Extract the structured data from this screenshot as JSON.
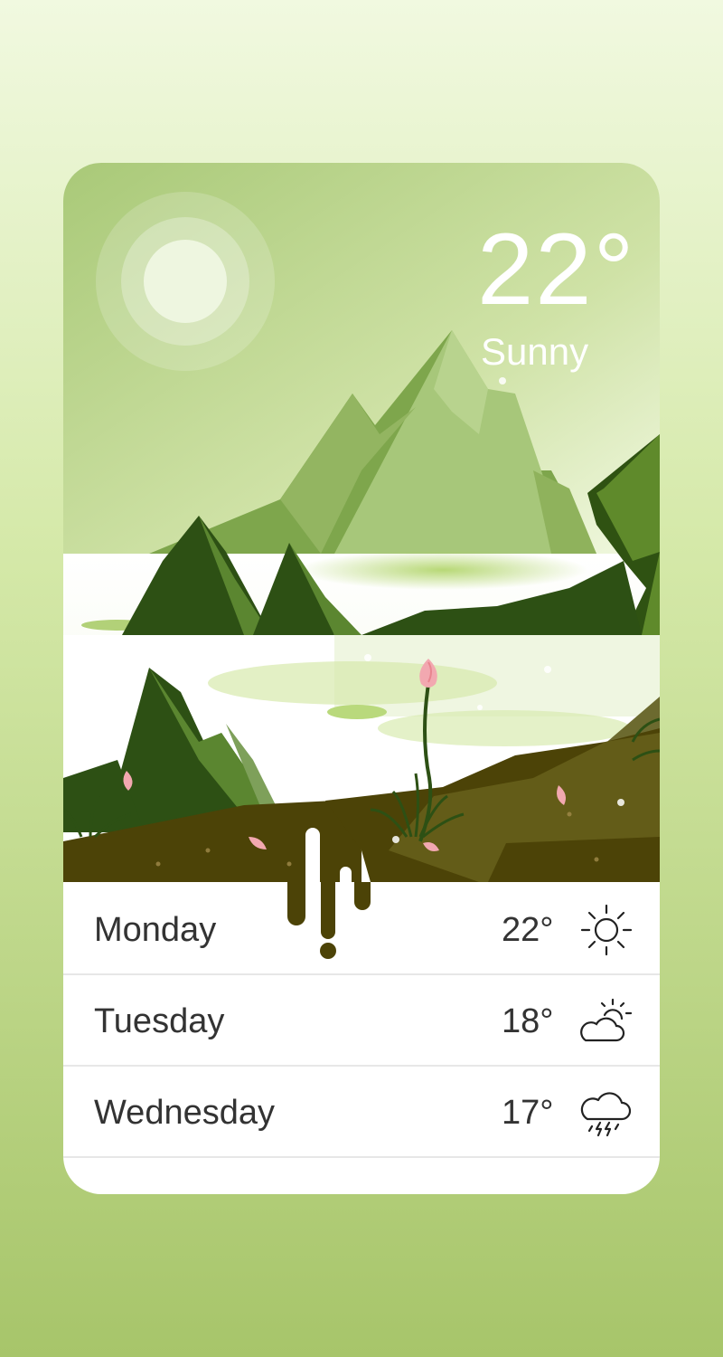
{
  "current": {
    "temperature": "22°",
    "condition": "Sunny"
  },
  "forecast": [
    {
      "day": "Monday",
      "temp": "22°",
      "icon": "sun-icon"
    },
    {
      "day": "Tuesday",
      "temp": "18°",
      "icon": "partly-cloudy-icon"
    },
    {
      "day": "Wednesday",
      "temp": "17°",
      "icon": "thunderstorm-icon"
    }
  ],
  "colors": {
    "sky": "#b8d489",
    "mountain_dark": "#2d5014",
    "mountain_mid": "#6f9a3d",
    "ground": "#4c4307",
    "petal": "#f2a8b0"
  }
}
